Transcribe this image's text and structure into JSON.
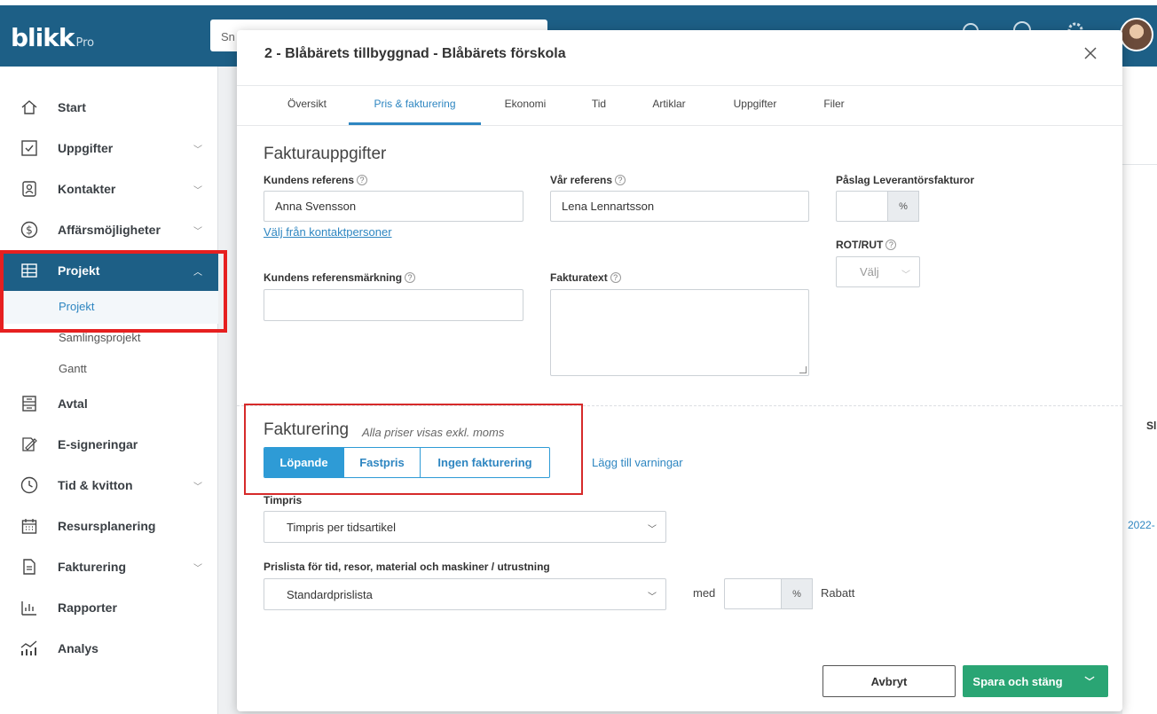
{
  "app": {
    "logo": "blikk",
    "logo_suffix": "Pro",
    "search_placeholder": "Sn"
  },
  "sidebar": {
    "items": [
      {
        "label": "Start",
        "icon": "home-icon"
      },
      {
        "label": "Uppgifter",
        "icon": "checkbox-icon"
      },
      {
        "label": "Kontakter",
        "icon": "contacts-icon"
      },
      {
        "label": "Affärsmöjligheter",
        "icon": "dollar-icon"
      },
      {
        "label": "Projekt",
        "icon": "table-icon"
      },
      {
        "label": "Avtal",
        "icon": "contract-icon"
      },
      {
        "label": "E-signeringar",
        "icon": "signature-icon"
      },
      {
        "label": "Tid & kvitton",
        "icon": "clock-icon"
      },
      {
        "label": "Resursplanering",
        "icon": "calendar-icon"
      },
      {
        "label": "Fakturering",
        "icon": "invoice-icon"
      },
      {
        "label": "Rapporter",
        "icon": "bar-chart-icon"
      },
      {
        "label": "Analys",
        "icon": "analytics-icon"
      }
    ],
    "sub_items": [
      "Projekt",
      "Samlingsprojekt",
      "Gantt"
    ]
  },
  "background": {
    "col_header": "Sl",
    "date_fragment": "2022-"
  },
  "modal": {
    "title": "2 - Blåbärets tillbyggnad - Blåbärets förskola",
    "tabs": [
      "Översikt",
      "Pris & fakturering",
      "Ekonomi",
      "Tid",
      "Artiklar",
      "Uppgifter",
      "Filer"
    ],
    "faktura": {
      "title": "Fakturauppgifter",
      "kundens_referens_label": "Kundens referens",
      "kundens_referens_value": "Anna Svensson",
      "valj_link": "Välj från kontaktpersoner",
      "var_referens_label": "Vår referens",
      "var_referens_value": "Lena Lennartsson",
      "paslag_label": "Påslag Leverantörsfakturor",
      "percent": "%",
      "rot_label": "ROT/RUT",
      "rot_value": "Välj",
      "refmarkning_label": "Kundens referensmärkning",
      "fakturatext_label": "Fakturatext"
    },
    "fakturering": {
      "title": "Fakturering",
      "subtitle": "Alla priser visas exkl. moms",
      "options": [
        "Löpande",
        "Fastpris",
        "Ingen fakturering"
      ],
      "selected": "Löpande",
      "warnings_link": "Lägg till varningar",
      "timpris_label": "Timpris",
      "timpris_value": "Timpris per tidsartikel",
      "prislista_label": "Prislista för tid, resor, material och maskiner / utrustning",
      "prislista_value": "Standardprislista",
      "med": "med",
      "percent": "%",
      "rabatt": "Rabatt"
    },
    "buttons": {
      "cancel": "Avbryt",
      "save": "Spara och stäng"
    }
  }
}
